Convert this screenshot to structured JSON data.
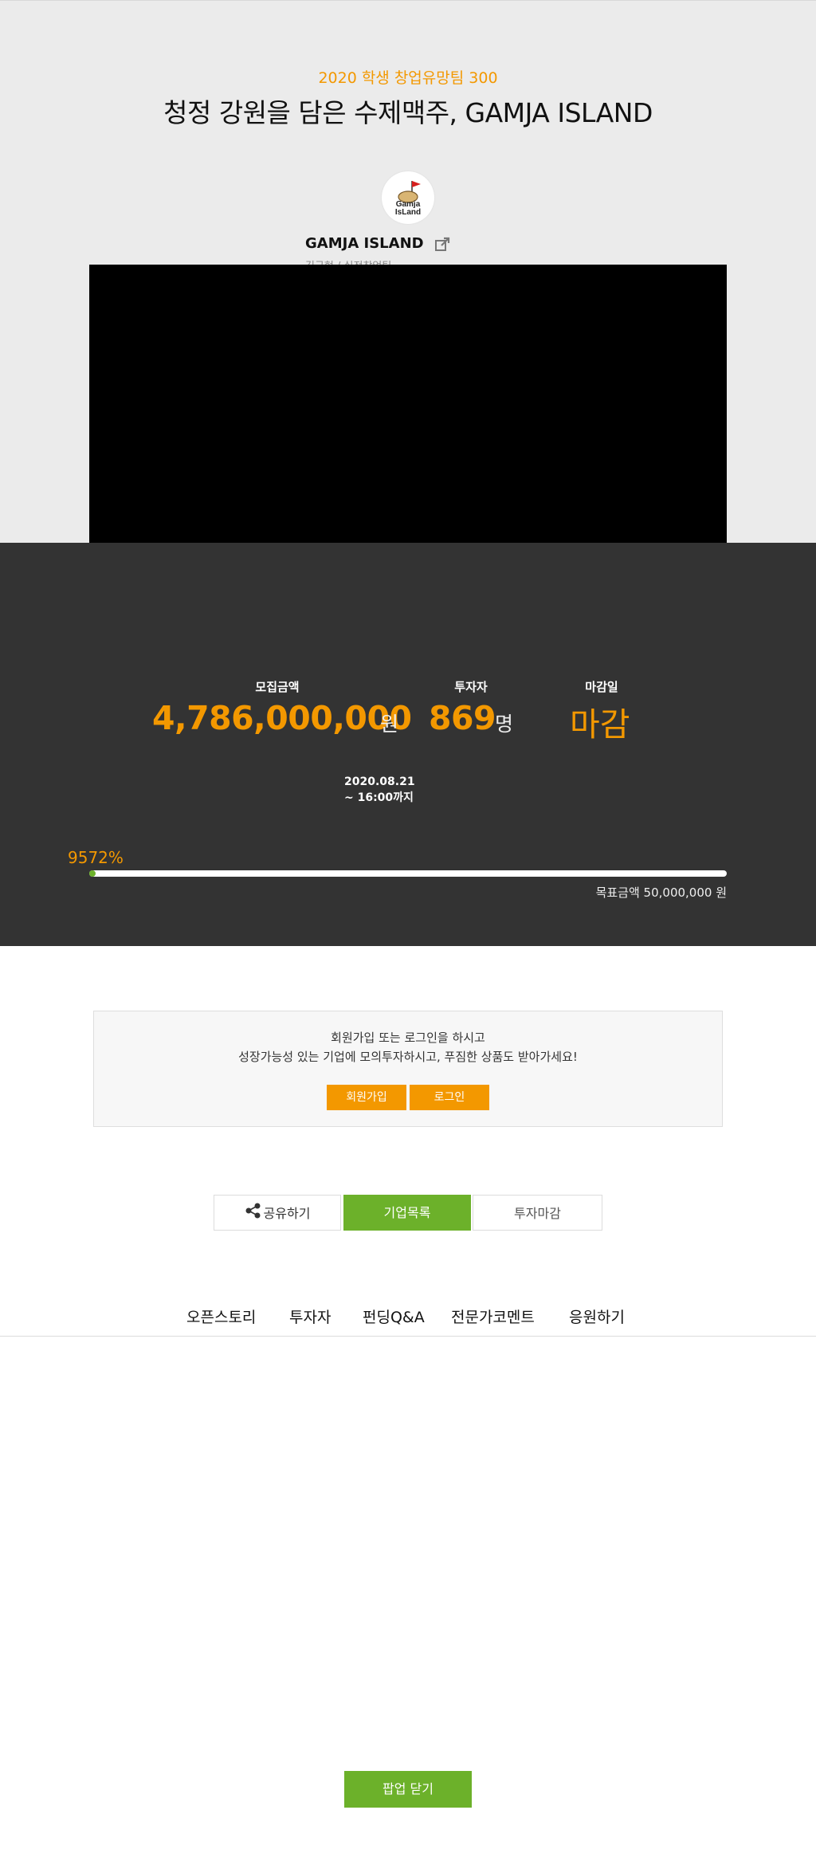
{
  "hero": {
    "kicker": "2020 학생 창업유망팀 300",
    "title": "청정 강원을 담은 수제맥주, GAMJA ISLAND",
    "logo_text_line1": "Gamja",
    "logo_text_line2": "IsLand",
    "company_name": "GAMJA ISLAND",
    "company_sub": "김규현 / 실전창업팀",
    "external_link_icon": "external-link-icon"
  },
  "stats": {
    "raised_label": "모집금액",
    "raised_value": "4,786,000,000",
    "raised_unit": "원",
    "investors_label": "투자자",
    "investors_value": "869",
    "investors_unit": "명",
    "deadline_label": "마감일",
    "deadline_value": "마감",
    "date_line1": "2020.08.21",
    "date_line2": "~ 16:00까지",
    "progress_percent_text": "9572%",
    "progress_percent": 9572,
    "goal_text": "목표금액 50,000,000 원"
  },
  "login_prompt": {
    "line1": "회원가입 또는 로그인을 하시고",
    "line2": "성장가능성 있는 기업에 모의투자하시고, 푸짐한 상품도 받아가세요!",
    "join_label": "회원가입",
    "login_label": "로그인"
  },
  "actions": {
    "share_label": "공유하기",
    "list_label": "기업목록",
    "closed_label": "투자마감"
  },
  "tabs": [
    "오픈스토리",
    "투자자",
    "펀딩Q&A",
    "전문가코멘트",
    "응원하기"
  ],
  "popup_button": "팝업 닫기",
  "colors": {
    "accent_orange": "#f39800",
    "accent_green": "#6cb12a",
    "dark_panel": "#333333",
    "hero_bg": "#ebebeb"
  }
}
